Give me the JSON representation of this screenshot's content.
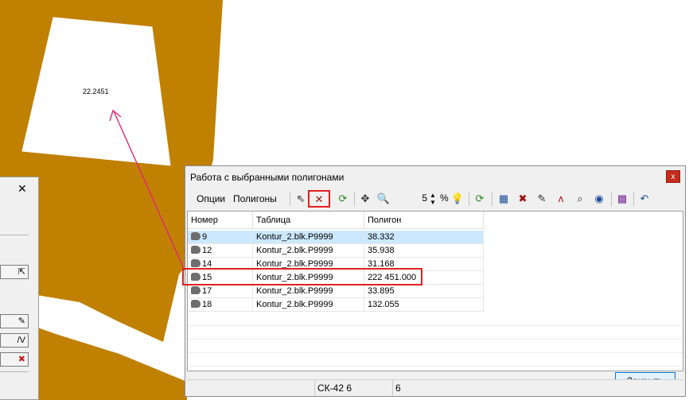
{
  "map": {
    "polygon_label": "22.2451",
    "colors": {
      "fill": "#c08000",
      "background": "#ffffff",
      "arrow": "#e0287a"
    }
  },
  "left_panel": {
    "close_glyph": "✕"
  },
  "dialog": {
    "title": "Работа с выбранными полигонами",
    "close_glyph": "x",
    "menu": {
      "options": "Опции",
      "polygons": "Полигоны"
    },
    "zoom_value": "5",
    "zoom_unit": "%",
    "columns": [
      "Номер",
      "Таблица",
      "Полигон"
    ],
    "rows": [
      {
        "num": "9",
        "table": "Kontur_2.blk.P9999",
        "polygon": "38.332"
      },
      {
        "num": "12",
        "table": "Kontur_2.blk.P9999",
        "polygon": "35.938"
      },
      {
        "num": "14",
        "table": "Kontur_2.blk.P9999",
        "polygon": "31.168"
      },
      {
        "num": "15",
        "table": "Kontur_2.blk.P9999",
        "polygon": "222 451.000"
      },
      {
        "num": "17",
        "table": "Kontur_2.blk.P9999",
        "polygon": "33.895"
      },
      {
        "num": "18",
        "table": "Kontur_2.blk.P9999",
        "polygon": "132.055"
      }
    ],
    "status": {
      "cs": "СК-42 6",
      "value": "6"
    },
    "close_button": "Закрыть",
    "icons": [
      "select-arrow-icon",
      "clear-selection-icon",
      "refresh-icon",
      "plus-icon",
      "zoom-icon",
      "bulb-icon",
      "refresh-green-icon",
      "layers-icon",
      "delete-layers-icon",
      "edit-icon",
      "polyline-icon",
      "zoom-object-icon",
      "globe-icon",
      "palette-icon",
      "undo-icon"
    ]
  }
}
